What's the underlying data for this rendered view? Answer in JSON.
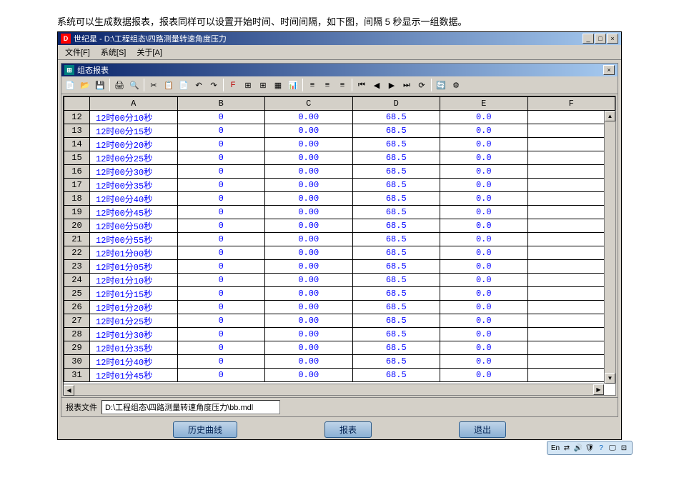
{
  "description": "系统可以生成数据报表，报表同样可以设置开始时间、时间间隔，如下图，间隔 5 秒显示一组数据。",
  "app": {
    "title": "世纪星 - D:\\工程组态\\四路测量转速角度压力",
    "menu": {
      "file": "文件[F]",
      "system": "系统[S]",
      "about": "关于[A]"
    }
  },
  "inner": {
    "title": "组态报表"
  },
  "columns": [
    "A",
    "B",
    "C",
    "D",
    "E",
    "F"
  ],
  "rows": [
    {
      "n": "12",
      "a": "12时00分10秒",
      "b": "0",
      "c": "0.00",
      "d": "68.5",
      "e": "0.0"
    },
    {
      "n": "13",
      "a": "12时00分15秒",
      "b": "0",
      "c": "0.00",
      "d": "68.5",
      "e": "0.0"
    },
    {
      "n": "14",
      "a": "12时00分20秒",
      "b": "0",
      "c": "0.00",
      "d": "68.5",
      "e": "0.0"
    },
    {
      "n": "15",
      "a": "12时00分25秒",
      "b": "0",
      "c": "0.00",
      "d": "68.5",
      "e": "0.0"
    },
    {
      "n": "16",
      "a": "12时00分30秒",
      "b": "0",
      "c": "0.00",
      "d": "68.5",
      "e": "0.0"
    },
    {
      "n": "17",
      "a": "12时00分35秒",
      "b": "0",
      "c": "0.00",
      "d": "68.5",
      "e": "0.0"
    },
    {
      "n": "18",
      "a": "12时00分40秒",
      "b": "0",
      "c": "0.00",
      "d": "68.5",
      "e": "0.0"
    },
    {
      "n": "19",
      "a": "12时00分45秒",
      "b": "0",
      "c": "0.00",
      "d": "68.5",
      "e": "0.0"
    },
    {
      "n": "20",
      "a": "12时00分50秒",
      "b": "0",
      "c": "0.00",
      "d": "68.5",
      "e": "0.0"
    },
    {
      "n": "21",
      "a": "12时00分55秒",
      "b": "0",
      "c": "0.00",
      "d": "68.5",
      "e": "0.0"
    },
    {
      "n": "22",
      "a": "12时01分00秒",
      "b": "0",
      "c": "0.00",
      "d": "68.5",
      "e": "0.0"
    },
    {
      "n": "23",
      "a": "12时01分05秒",
      "b": "0",
      "c": "0.00",
      "d": "68.5",
      "e": "0.0"
    },
    {
      "n": "24",
      "a": "12时01分10秒",
      "b": "0",
      "c": "0.00",
      "d": "68.5",
      "e": "0.0"
    },
    {
      "n": "25",
      "a": "12时01分15秒",
      "b": "0",
      "c": "0.00",
      "d": "68.5",
      "e": "0.0"
    },
    {
      "n": "26",
      "a": "12时01分20秒",
      "b": "0",
      "c": "0.00",
      "d": "68.5",
      "e": "0.0"
    },
    {
      "n": "27",
      "a": "12时01分25秒",
      "b": "0",
      "c": "0.00",
      "d": "68.5",
      "e": "0.0"
    },
    {
      "n": "28",
      "a": "12时01分30秒",
      "b": "0",
      "c": "0.00",
      "d": "68.5",
      "e": "0.0"
    },
    {
      "n": "29",
      "a": "12时01分35秒",
      "b": "0",
      "c": "0.00",
      "d": "68.5",
      "e": "0.0"
    },
    {
      "n": "30",
      "a": "12时01分40秒",
      "b": "0",
      "c": "0.00",
      "d": "68.5",
      "e": "0.0"
    },
    {
      "n": "31",
      "a": "12时01分45秒",
      "b": "0",
      "c": "0.00",
      "d": "68.5",
      "e": "0.0"
    }
  ],
  "status": {
    "label": "报表文件",
    "path": "D:\\工程组态\\四路测量转速角度压力\\bb.mdl"
  },
  "buttons": {
    "history": "历史曲线",
    "report": "报表",
    "exit": "退出"
  },
  "tray": {
    "lang": "En"
  }
}
